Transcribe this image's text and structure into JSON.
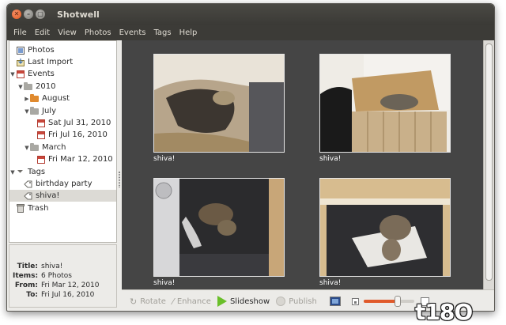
{
  "window": {
    "title": "Shotwell",
    "buttons": {
      "close": "✕",
      "minimize": "–",
      "maximize": "▢"
    }
  },
  "menu": [
    "File",
    "Edit",
    "View",
    "Photos",
    "Events",
    "Tags",
    "Help"
  ],
  "sidebar": {
    "items": [
      {
        "label": "Photos",
        "icon": "photos-icon"
      },
      {
        "label": "Last Import",
        "icon": "import-icon"
      },
      {
        "label": "Events",
        "icon": "events-icon"
      },
      {
        "label": "2010",
        "icon": "folder-icon"
      },
      {
        "label": "August",
        "icon": "folder-icon"
      },
      {
        "label": "July",
        "icon": "folder-icon"
      },
      {
        "label": "Sat Jul 31, 2010",
        "icon": "event-icon"
      },
      {
        "label": "Fri Jul 16, 2010",
        "icon": "event-icon"
      },
      {
        "label": "March",
        "icon": "folder-icon"
      },
      {
        "label": "Fri Mar 12, 2010",
        "icon": "event-icon"
      },
      {
        "label": "Tags",
        "icon": "tags-icon"
      },
      {
        "label": "birthday party",
        "icon": "tag-icon"
      },
      {
        "label": "shiva!",
        "icon": "tag-icon",
        "selected": true
      },
      {
        "label": "Trash",
        "icon": "trash-icon"
      }
    ]
  },
  "info": {
    "title_key": "Title:",
    "title_val": "shiva!",
    "items_key": "Items:",
    "items_val": "6 Photos",
    "from_key": "From:",
    "from_val": "Fri Mar 12, 2010",
    "to_key": "To:",
    "to_val": "Fri Jul 16, 2010"
  },
  "photos": [
    {
      "caption": "shiva!"
    },
    {
      "caption": "shiva!"
    },
    {
      "caption": "shiva!"
    },
    {
      "caption": "shiva!"
    }
  ],
  "toolbar": {
    "rotate": "Rotate",
    "enhance": "Enhance",
    "slideshow": "Slideshow",
    "publish": "Publish",
    "zoom_level": 0.68
  },
  "watermark": "t18O",
  "colors": {
    "accent": "#e05a2b",
    "play": "#6abf2a",
    "viewer_bg": "#454545"
  }
}
